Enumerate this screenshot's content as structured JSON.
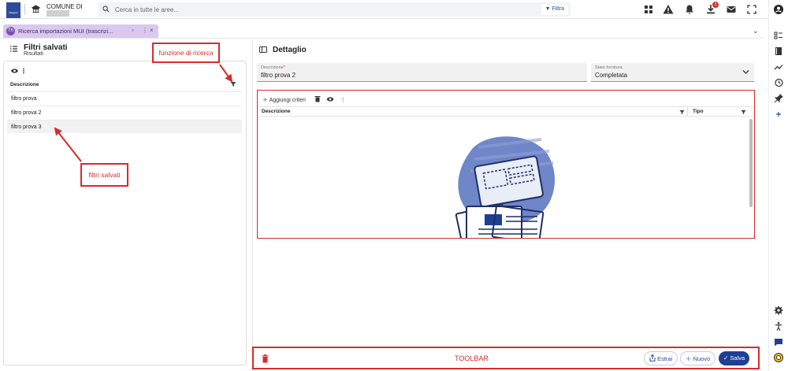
{
  "header": {
    "logo_text": "Maggioli",
    "municipality_label": "COMUNE DI",
    "search_placeholder": "Cerca in tutte le aree...",
    "filter_button": "Filtra",
    "downloads_badge": "3"
  },
  "tab": {
    "icon_text": "Th",
    "label": "Ricerca importazioni MUI (trascrizi...",
    "active_color": "#d9c9ef"
  },
  "saved_filters": {
    "title": "Filtri salvati",
    "subtitle": "Risultati",
    "column_header": "Descrizione",
    "rows": [
      "filtro prova",
      "filtro prova 2",
      "filtro prova 3"
    ]
  },
  "detail": {
    "title": "Dettaglio",
    "description_field": {
      "label": "Descrizione",
      "required_mark": "*",
      "value": "filtro prova 2"
    },
    "status_field": {
      "label": "Stato fornitura",
      "value": "Completata"
    },
    "criteria": {
      "add_button": "Aggiungi criteri",
      "columns": [
        "Descrizione",
        "Tipo"
      ]
    }
  },
  "toolbar": {
    "label": "TOOLBAR",
    "extract_button": "Estrai",
    "new_button": "Nuovo",
    "save_button": "Salva"
  },
  "annotations": {
    "search_function": "funzione di ricerca",
    "saved_filters": "filtri salvati",
    "color": "#d92b2b"
  },
  "colors": {
    "primary": "#1f3f94",
    "accent_red": "#d92b2b"
  }
}
